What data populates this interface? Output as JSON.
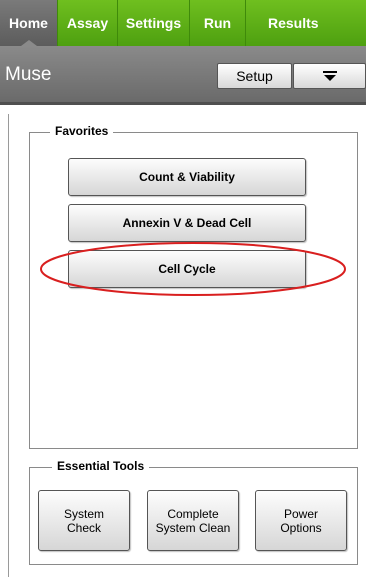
{
  "tabs": [
    {
      "label": "Home"
    },
    {
      "label": "Assay"
    },
    {
      "label": "Settings"
    },
    {
      "label": "Run"
    },
    {
      "label": "Results"
    }
  ],
  "header": {
    "title": "Muse",
    "setup_label": "Setup",
    "menu_icon": "dropdown-menu-icon"
  },
  "favorites": {
    "legend": "Favorites",
    "buttons": [
      "Count & Viability",
      "Annexin V & Dead Cell",
      "Cell Cycle"
    ],
    "highlighted": "Cell Cycle",
    "highlight_color": "#d91f1f"
  },
  "tools": {
    "legend": "Essential Tools",
    "buttons": [
      {
        "line1": "System",
        "line2": "Check"
      },
      {
        "line1": "Complete",
        "line2": "System Clean"
      },
      {
        "line1": "Power",
        "line2": "Options"
      }
    ]
  },
  "colors": {
    "tab_green": "#5aad14",
    "tab_active_gray": "#6a6a6a",
    "header_gray": "#7a7a7a"
  }
}
